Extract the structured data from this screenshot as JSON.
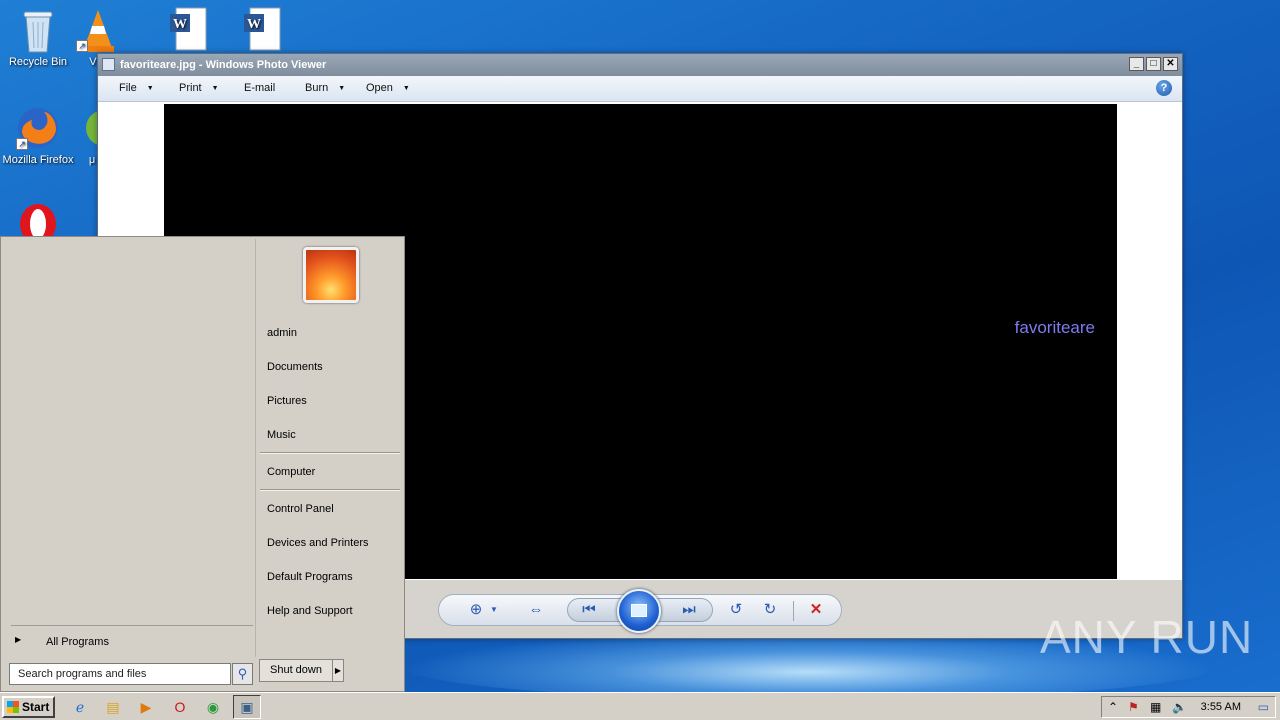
{
  "desktop": {
    "icons": [
      {
        "label": "Recycle Bin"
      },
      {
        "label": "VL"
      },
      {
        "label": ""
      },
      {
        "label": ""
      },
      {
        "label": "Mozilla Firefox"
      },
      {
        "label": "μ"
      },
      {
        "label": ""
      }
    ]
  },
  "viewer": {
    "title": "favoriteare.jpg - Windows Photo Viewer",
    "menu": {
      "file": "File",
      "print": "Print",
      "email": "E-mail",
      "burn": "Burn",
      "open": "Open"
    },
    "photo_caption": "favoriteare"
  },
  "start_menu": {
    "user_name": "admin",
    "links": {
      "documents": "Documents",
      "pictures": "Pictures",
      "music": "Music",
      "computer": "Computer",
      "control_panel": "Control Panel",
      "devices_printers": "Devices and Printers",
      "default_programs": "Default Programs",
      "help_support": "Help and Support"
    },
    "all_programs": "All Programs",
    "search_placeholder": "Search programs and files",
    "shutdown": "Shut down"
  },
  "taskbar": {
    "start_label": "Start",
    "clock": "3:55 AM"
  },
  "watermark": "ANY RUN",
  "colors": {
    "caption": "#7d7bf0",
    "desktop": "#1464c2"
  }
}
